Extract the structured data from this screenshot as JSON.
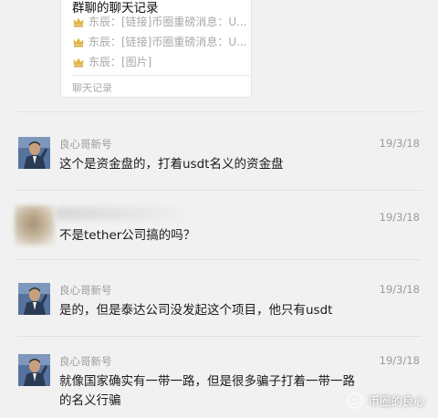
{
  "forward_card": {
    "title": "群聊的聊天记录",
    "lines": [
      {
        "sender": "东辰",
        "text": "东辰：[链接]币圈重磅消息：U..."
      },
      {
        "sender": "东辰",
        "text": "东辰：[链接]币圈重磅消息：U..."
      },
      {
        "sender": "东辰",
        "text": "东辰：[图片]"
      }
    ],
    "footer": "聊天记录"
  },
  "messages": [
    {
      "sender": "良心哥新号",
      "time": "19/3/18",
      "text": "这个是资金盘的，打着usdt名义的资金盘"
    },
    {
      "sender": "",
      "time": "19/3/18",
      "text": "不是tether公司搞的吗？"
    },
    {
      "sender": "良心哥新号",
      "time": "19/3/18",
      "text": "是的，但是泰达公司没发起这个项目，他只有usdt"
    },
    {
      "sender": "良心哥新号",
      "time": "19/3/18",
      "text": "就像国家确实有一带一路，但是很多骗子打着一带一路的名义行骗"
    }
  ],
  "watermark": "币圈的良心",
  "colors": {
    "background": "#f1f1f1",
    "meta_text": "#9b9b9b",
    "crown": "#e0b84a"
  }
}
